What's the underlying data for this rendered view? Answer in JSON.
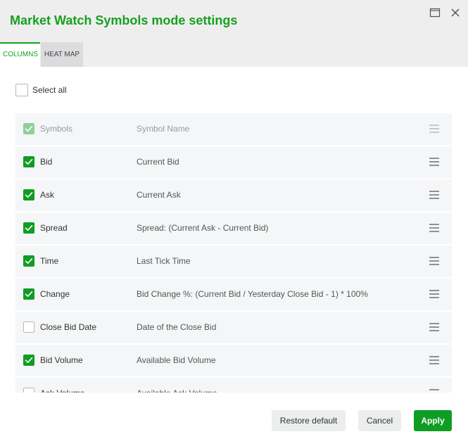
{
  "dialog": {
    "title": "Market Watch Symbols mode settings"
  },
  "tabs": [
    {
      "label": "COLUMNS",
      "active": true
    },
    {
      "label": "HEAT MAP",
      "active": false
    }
  ],
  "select_all": {
    "label": "Select all",
    "checked": false
  },
  "columns": [
    {
      "name": "Symbols",
      "description": "Symbol Name",
      "checked": true,
      "disabled": true
    },
    {
      "name": "Bid",
      "description": "Current Bid",
      "checked": true,
      "disabled": false
    },
    {
      "name": "Ask",
      "description": "Current Ask",
      "checked": true,
      "disabled": false
    },
    {
      "name": "Spread",
      "description": "Spread: (Current Ask - Current Bid)",
      "checked": true,
      "disabled": false
    },
    {
      "name": "Time",
      "description": "Last Tick Time",
      "checked": true,
      "disabled": false
    },
    {
      "name": "Change",
      "description": "Bid Change %: (Current Bid / Yesterday Close Bid - 1) * 100%",
      "checked": true,
      "disabled": false
    },
    {
      "name": "Close Bid Date",
      "description": "Date of the Close Bid",
      "checked": false,
      "disabled": false
    },
    {
      "name": "Bid Volume",
      "description": "Available Bid Volume",
      "checked": true,
      "disabled": false
    },
    {
      "name": "Ask Volume",
      "description": "Available Ask Volume",
      "checked": false,
      "disabled": false
    }
  ],
  "buttons": {
    "restore_label": "Restore default",
    "cancel_label": "Cancel",
    "apply_label": "Apply"
  },
  "colors": {
    "accent": "#15a11e",
    "checkbox_checked": "#0f9d23",
    "checkbox_disabled": "#8fd19a",
    "header_bg": "#eeeeef",
    "row_bg": "#f5f6f7"
  },
  "icons": {
    "maximize": "maximize-window-icon",
    "close": "close-icon",
    "drag": "drag-handle-icon",
    "check": "checkmark-icon"
  }
}
